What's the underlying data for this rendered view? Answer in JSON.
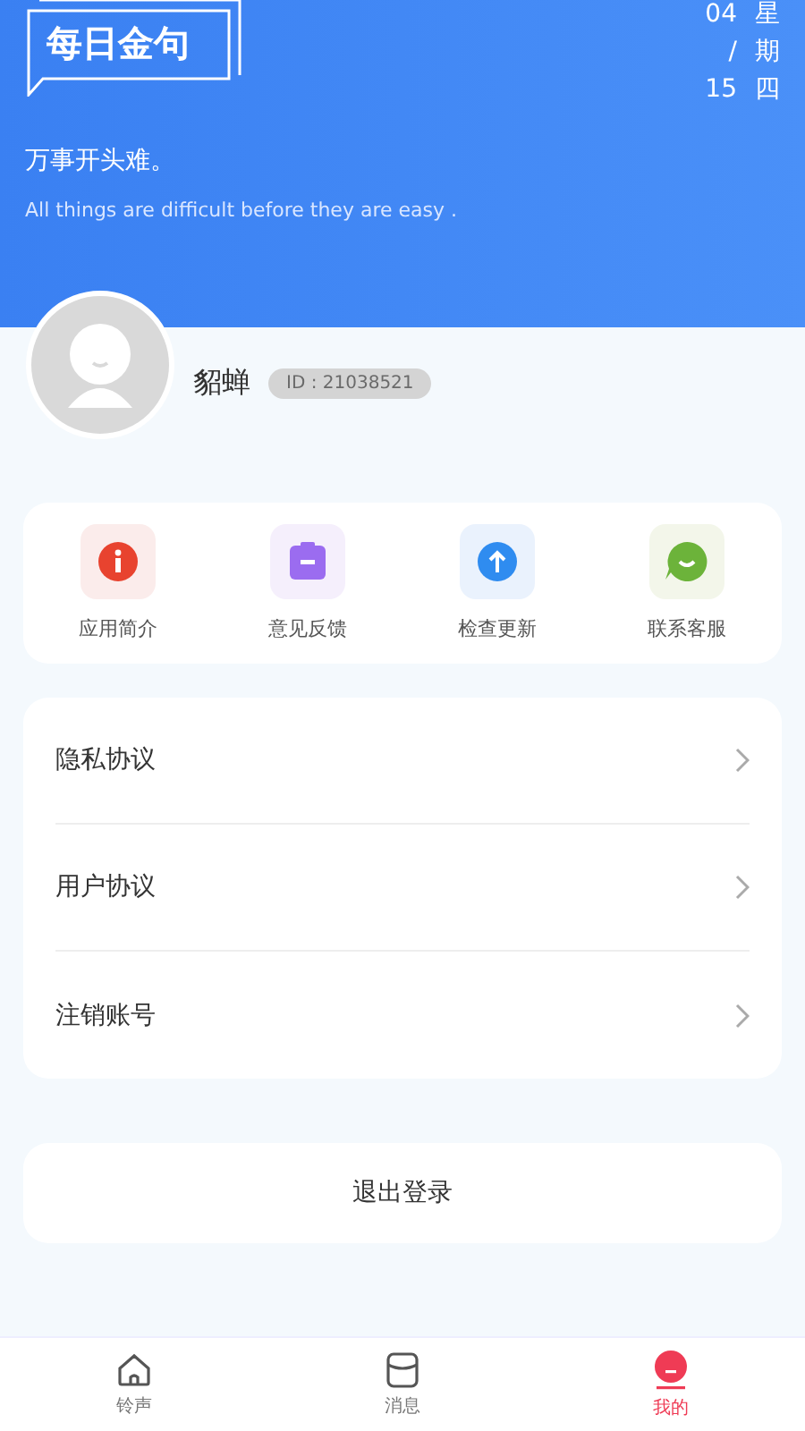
{
  "banner": {
    "title": "每日金句",
    "date_numbers": [
      "04",
      "/",
      "15"
    ],
    "weekday": "星期四",
    "quote_zh": "万事开头难。",
    "quote_en": "All things are difficult before they are easy ."
  },
  "profile": {
    "name": "貂蝉",
    "id_badge": "ID : 21038521"
  },
  "shortcuts": [
    {
      "kind": "info",
      "label": "应用简介"
    },
    {
      "kind": "feedback",
      "label": "意见反馈"
    },
    {
      "kind": "update",
      "label": "检查更新"
    },
    {
      "kind": "service",
      "label": "联系客服"
    }
  ],
  "menu": [
    {
      "label": "隐私协议"
    },
    {
      "label": "用户协议"
    },
    {
      "label": "注销账号"
    }
  ],
  "logout_button": "退出登录",
  "tabs": [
    {
      "kind": "home",
      "label": "铃声",
      "selected": false
    },
    {
      "kind": "message",
      "label": "消息",
      "selected": false
    },
    {
      "kind": "me",
      "label": "我的",
      "selected": true
    }
  ]
}
